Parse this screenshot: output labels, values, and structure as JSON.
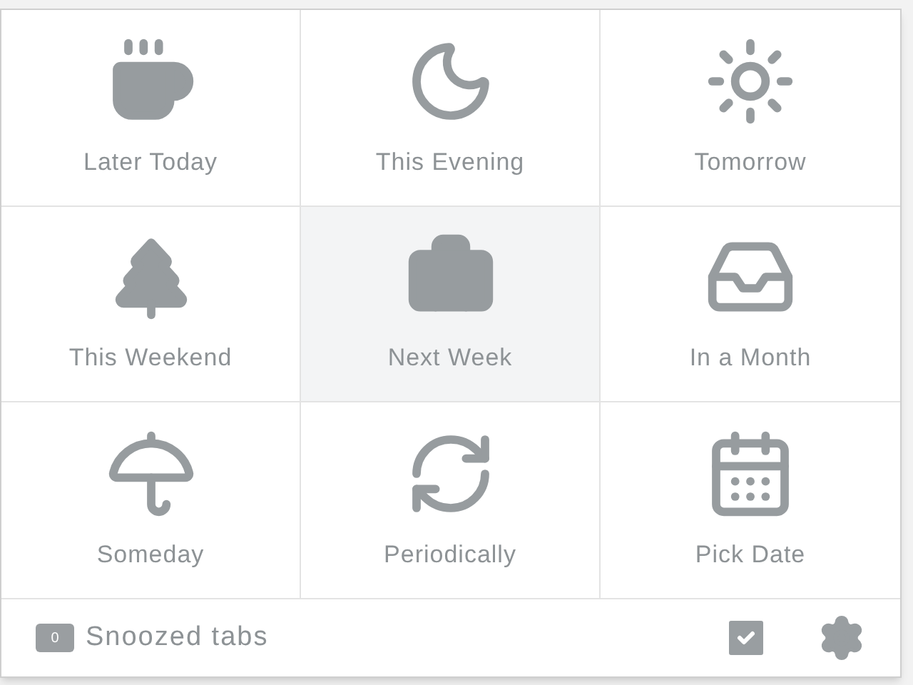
{
  "options": [
    {
      "label": "Later Today",
      "selected": false
    },
    {
      "label": "This Evening",
      "selected": false
    },
    {
      "label": "Tomorrow",
      "selected": false
    },
    {
      "label": "This Weekend",
      "selected": false
    },
    {
      "label": "Next Week",
      "selected": true
    },
    {
      "label": "In a Month",
      "selected": false
    },
    {
      "label": "Someday",
      "selected": false
    },
    {
      "label": "Periodically",
      "selected": false
    },
    {
      "label": "Pick Date",
      "selected": false
    }
  ],
  "footer": {
    "count": "0",
    "label": "Snoozed tabs"
  }
}
